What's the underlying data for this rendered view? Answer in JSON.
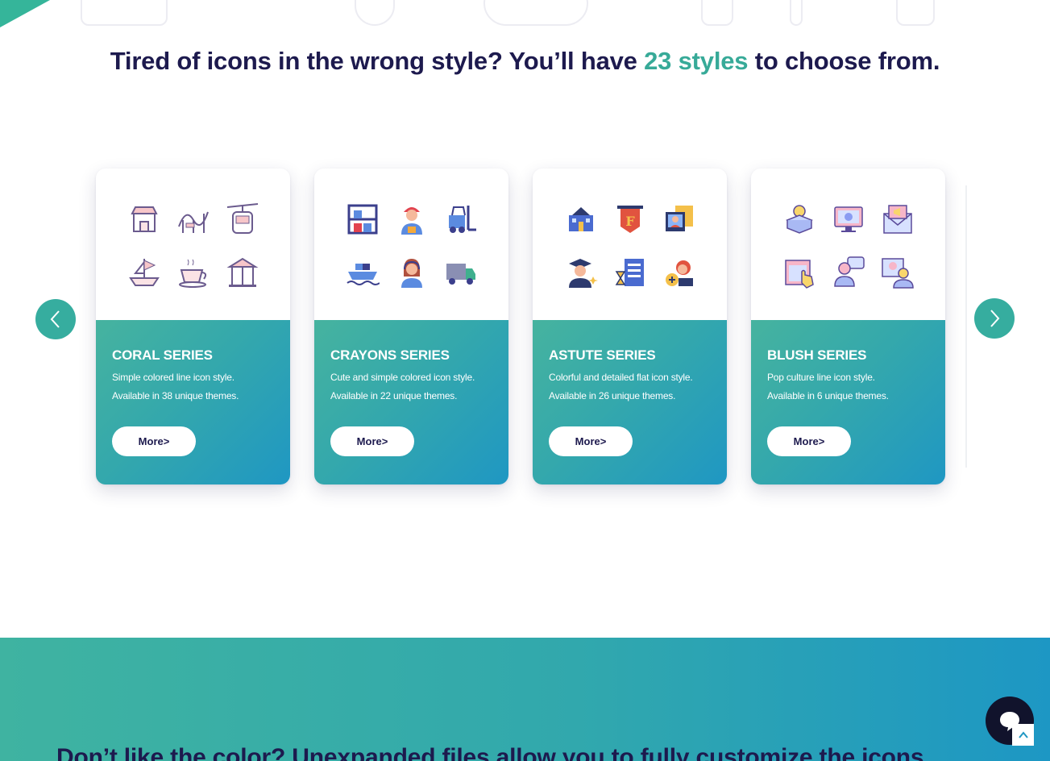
{
  "headline": {
    "before": "Tired of icons in the wrong style? You’ll have ",
    "accent": "23 styles",
    "after": " to choose from."
  },
  "colors": {
    "accent": "#37aa98",
    "navy": "#1d1a4e",
    "gradient_start": "#46b39f",
    "gradient_end": "#1f97c3"
  },
  "carousel": {
    "prev_icon": "chevron-left-icon",
    "next_icon": "chevron-right-icon",
    "cards": [
      {
        "title": "CORAL SERIES",
        "line1": "Simple colored line icon style.",
        "line2": "Available in 38 unique themes.",
        "button": "More>",
        "icons": [
          "shop-icon",
          "roller-coaster-icon",
          "cable-car-icon",
          "pirate-ship-icon",
          "teacup-ride-icon",
          "carousel-icon"
        ]
      },
      {
        "title": "CRAYONS SERIES",
        "line1": "Cute and simple colored icon style.",
        "line2": "Available in 22 unique themes.",
        "button": "More>",
        "icons": [
          "warehouse-shelf-icon",
          "delivery-worker-icon",
          "forklift-icon",
          "cargo-ship-icon",
          "support-agent-icon",
          "delivery-truck-icon"
        ]
      },
      {
        "title": "ASTUTE SERIES",
        "line1": "Colorful and detailed flat icon style.",
        "line2": "Available in 26 unique themes.",
        "button": "More>",
        "icons": [
          "school-building-icon",
          "pennant-f-icon",
          "online-lesson-icon",
          "graduate-icon",
          "hourglass-checklist-icon",
          "student-idea-icon"
        ]
      },
      {
        "title": "BLUSH SERIES",
        "line1": "Pop culture line icon style.",
        "line2": "Available in 6 unique themes.",
        "button": "More>",
        "icons": [
          "idea-box-icon",
          "monitor-settings-icon",
          "email-megaphone-icon",
          "touch-screen-icon",
          "user-chat-icon",
          "video-call-icon"
        ]
      }
    ]
  },
  "band": {
    "heading": "Don’t like the color? Unexpanded files allow you to fully customize the icons."
  },
  "widgets": {
    "chat_icon": "chat-bubble-icon",
    "scroll_top_icon": "arrow-up-icon"
  }
}
